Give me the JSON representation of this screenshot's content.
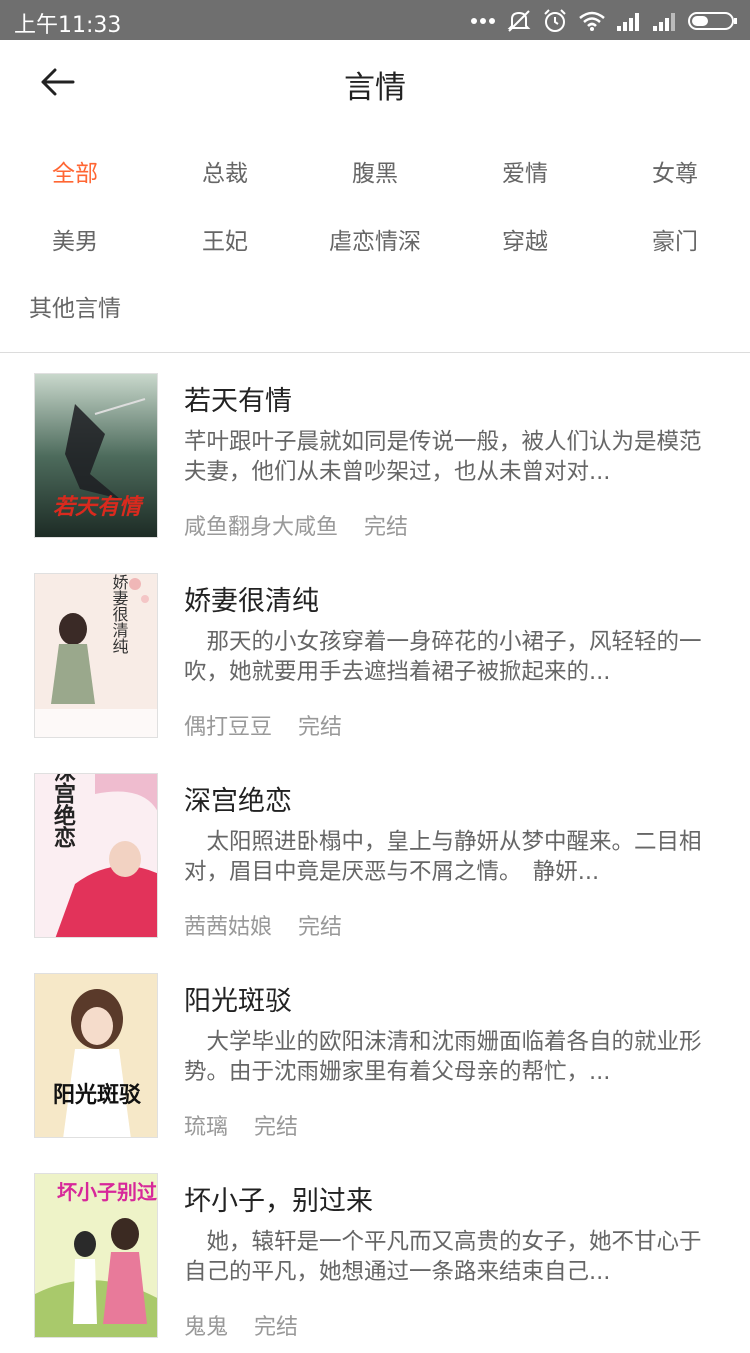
{
  "status_bar": {
    "time": "上午11:33"
  },
  "header": {
    "title": "言情",
    "back_icon": "arrow-left-icon"
  },
  "tags": [
    {
      "label": "全部",
      "active": true
    },
    {
      "label": "总裁",
      "active": false
    },
    {
      "label": "腹黑",
      "active": false
    },
    {
      "label": "爱情",
      "active": false
    },
    {
      "label": "女尊",
      "active": false
    },
    {
      "label": "美男",
      "active": false
    },
    {
      "label": "王妃",
      "active": false
    },
    {
      "label": "虐恋情深",
      "active": false
    },
    {
      "label": "穿越",
      "active": false
    },
    {
      "label": "豪门",
      "active": false
    },
    {
      "label": "其他言情",
      "active": false
    }
  ],
  "colors": {
    "accent": "#ff6633",
    "statusbar": "#6f6f6f"
  },
  "books": [
    {
      "title": "若天有情",
      "description": "芊叶跟叶子晨就如同是传说一般，被人们认为是模范夫妻，他们从未曾吵架过，也从未曾对对...",
      "author": "咸鱼翻身大咸鱼",
      "status": "完结",
      "cover_text": "若天有情"
    },
    {
      "title": "娇妻很清纯",
      "description": "　那天的小女孩穿着一身碎花的小裙子，风轻轻的一吹，她就要用手去遮挡着裙子被掀起来的...",
      "author": "偶打豆豆",
      "status": "完结",
      "cover_text": "娇妻很清纯"
    },
    {
      "title": "深宫绝恋",
      "description": "　太阳照进卧榻中，皇上与静妍从梦中醒来。二目相对，眉目中竟是厌恶与不屑之情。　静妍...",
      "author": "茜茜姑娘",
      "status": "完结",
      "cover_text": "深宫绝恋"
    },
    {
      "title": "阳光斑驳",
      "description": "　大学毕业的欧阳沫清和沈雨姗面临着各自的就业形势。由于沈雨姗家里有着父母亲的帮忙，...",
      "author": "琉璃",
      "status": "完结",
      "cover_text": "阳光斑驳"
    },
    {
      "title": "坏小子，别过来",
      "description": "　她，辕轩是一个平凡而又高贵的女子，她不甘心于自己的平凡，她想通过一条路来结束自己...",
      "author": "鬼鬼",
      "status": "完结",
      "cover_text": "坏小子别过来"
    }
  ]
}
